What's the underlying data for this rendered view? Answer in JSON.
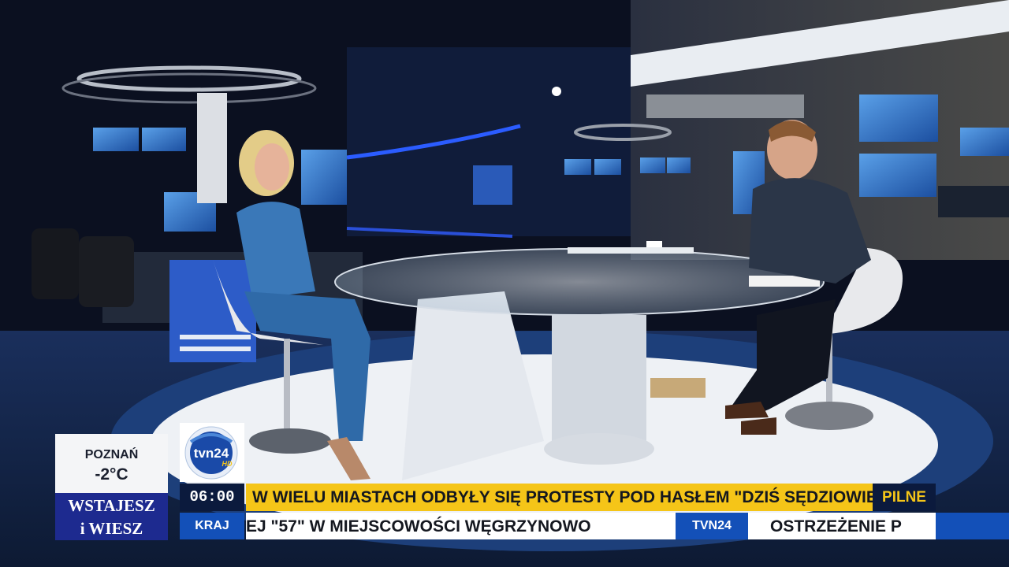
{
  "weather": {
    "city": "POZNAŃ",
    "temperature": "-2°C"
  },
  "show": {
    "line1": "WSTAJESZ",
    "line2": "i WIESZ"
  },
  "logo": {
    "brand": "tvn24",
    "sub": "HD"
  },
  "clock": {
    "time": "06:00"
  },
  "category": {
    "label": "KRAJ"
  },
  "headline": {
    "text": "W WIELU MIASTACH ODBYŁY SIĘ PROTESTY POD HASŁEM \"DZIŚ SĘDZIOWIE - JUTRO TY\"",
    "badge": "PILNE"
  },
  "ticker": {
    "left_text": "EJ \"57\" W MIEJSCOWOŚCI WĘGRZYNOWO",
    "separator": "TVN24",
    "right_text": "OSTRZEŻENIE P"
  },
  "colors": {
    "headline_bg": "#f5c518",
    "brand_blue": "#1350b8",
    "navy": "#0b1a3d",
    "show_blue": "#1d2a8f"
  }
}
